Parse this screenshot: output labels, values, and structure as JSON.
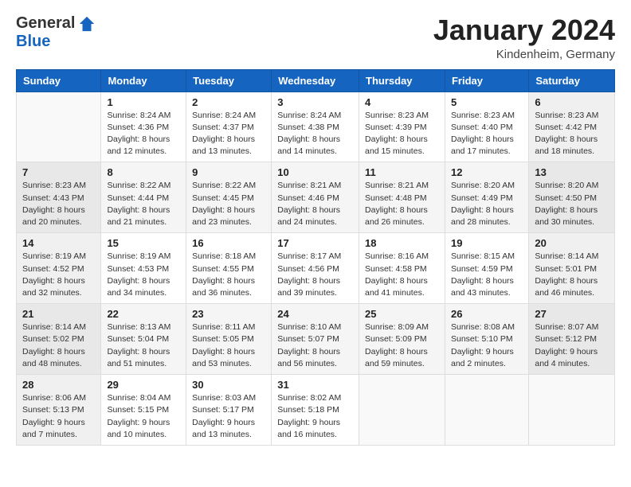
{
  "header": {
    "logo_general": "General",
    "logo_blue": "Blue",
    "month_title": "January 2024",
    "subtitle": "Kindenheim, Germany"
  },
  "days_of_week": [
    "Sunday",
    "Monday",
    "Tuesday",
    "Wednesday",
    "Thursday",
    "Friday",
    "Saturday"
  ],
  "weeks": [
    [
      {
        "num": "",
        "info": ""
      },
      {
        "num": "1",
        "info": "Sunrise: 8:24 AM\nSunset: 4:36 PM\nDaylight: 8 hours\nand 12 minutes."
      },
      {
        "num": "2",
        "info": "Sunrise: 8:24 AM\nSunset: 4:37 PM\nDaylight: 8 hours\nand 13 minutes."
      },
      {
        "num": "3",
        "info": "Sunrise: 8:24 AM\nSunset: 4:38 PM\nDaylight: 8 hours\nand 14 minutes."
      },
      {
        "num": "4",
        "info": "Sunrise: 8:23 AM\nSunset: 4:39 PM\nDaylight: 8 hours\nand 15 minutes."
      },
      {
        "num": "5",
        "info": "Sunrise: 8:23 AM\nSunset: 4:40 PM\nDaylight: 8 hours\nand 17 minutes."
      },
      {
        "num": "6",
        "info": "Sunrise: 8:23 AM\nSunset: 4:42 PM\nDaylight: 8 hours\nand 18 minutes."
      }
    ],
    [
      {
        "num": "7",
        "info": "Sunrise: 8:23 AM\nSunset: 4:43 PM\nDaylight: 8 hours\nand 20 minutes."
      },
      {
        "num": "8",
        "info": "Sunrise: 8:22 AM\nSunset: 4:44 PM\nDaylight: 8 hours\nand 21 minutes."
      },
      {
        "num": "9",
        "info": "Sunrise: 8:22 AM\nSunset: 4:45 PM\nDaylight: 8 hours\nand 23 minutes."
      },
      {
        "num": "10",
        "info": "Sunrise: 8:21 AM\nSunset: 4:46 PM\nDaylight: 8 hours\nand 24 minutes."
      },
      {
        "num": "11",
        "info": "Sunrise: 8:21 AM\nSunset: 4:48 PM\nDaylight: 8 hours\nand 26 minutes."
      },
      {
        "num": "12",
        "info": "Sunrise: 8:20 AM\nSunset: 4:49 PM\nDaylight: 8 hours\nand 28 minutes."
      },
      {
        "num": "13",
        "info": "Sunrise: 8:20 AM\nSunset: 4:50 PM\nDaylight: 8 hours\nand 30 minutes."
      }
    ],
    [
      {
        "num": "14",
        "info": "Sunrise: 8:19 AM\nSunset: 4:52 PM\nDaylight: 8 hours\nand 32 minutes."
      },
      {
        "num": "15",
        "info": "Sunrise: 8:19 AM\nSunset: 4:53 PM\nDaylight: 8 hours\nand 34 minutes."
      },
      {
        "num": "16",
        "info": "Sunrise: 8:18 AM\nSunset: 4:55 PM\nDaylight: 8 hours\nand 36 minutes."
      },
      {
        "num": "17",
        "info": "Sunrise: 8:17 AM\nSunset: 4:56 PM\nDaylight: 8 hours\nand 39 minutes."
      },
      {
        "num": "18",
        "info": "Sunrise: 8:16 AM\nSunset: 4:58 PM\nDaylight: 8 hours\nand 41 minutes."
      },
      {
        "num": "19",
        "info": "Sunrise: 8:15 AM\nSunset: 4:59 PM\nDaylight: 8 hours\nand 43 minutes."
      },
      {
        "num": "20",
        "info": "Sunrise: 8:14 AM\nSunset: 5:01 PM\nDaylight: 8 hours\nand 46 minutes."
      }
    ],
    [
      {
        "num": "21",
        "info": "Sunrise: 8:14 AM\nSunset: 5:02 PM\nDaylight: 8 hours\nand 48 minutes."
      },
      {
        "num": "22",
        "info": "Sunrise: 8:13 AM\nSunset: 5:04 PM\nDaylight: 8 hours\nand 51 minutes."
      },
      {
        "num": "23",
        "info": "Sunrise: 8:11 AM\nSunset: 5:05 PM\nDaylight: 8 hours\nand 53 minutes."
      },
      {
        "num": "24",
        "info": "Sunrise: 8:10 AM\nSunset: 5:07 PM\nDaylight: 8 hours\nand 56 minutes."
      },
      {
        "num": "25",
        "info": "Sunrise: 8:09 AM\nSunset: 5:09 PM\nDaylight: 8 hours\nand 59 minutes."
      },
      {
        "num": "26",
        "info": "Sunrise: 8:08 AM\nSunset: 5:10 PM\nDaylight: 9 hours\nand 2 minutes."
      },
      {
        "num": "27",
        "info": "Sunrise: 8:07 AM\nSunset: 5:12 PM\nDaylight: 9 hours\nand 4 minutes."
      }
    ],
    [
      {
        "num": "28",
        "info": "Sunrise: 8:06 AM\nSunset: 5:13 PM\nDaylight: 9 hours\nand 7 minutes."
      },
      {
        "num": "29",
        "info": "Sunrise: 8:04 AM\nSunset: 5:15 PM\nDaylight: 9 hours\nand 10 minutes."
      },
      {
        "num": "30",
        "info": "Sunrise: 8:03 AM\nSunset: 5:17 PM\nDaylight: 9 hours\nand 13 minutes."
      },
      {
        "num": "31",
        "info": "Sunrise: 8:02 AM\nSunset: 5:18 PM\nDaylight: 9 hours\nand 16 minutes."
      },
      {
        "num": "",
        "info": ""
      },
      {
        "num": "",
        "info": ""
      },
      {
        "num": "",
        "info": ""
      }
    ]
  ]
}
